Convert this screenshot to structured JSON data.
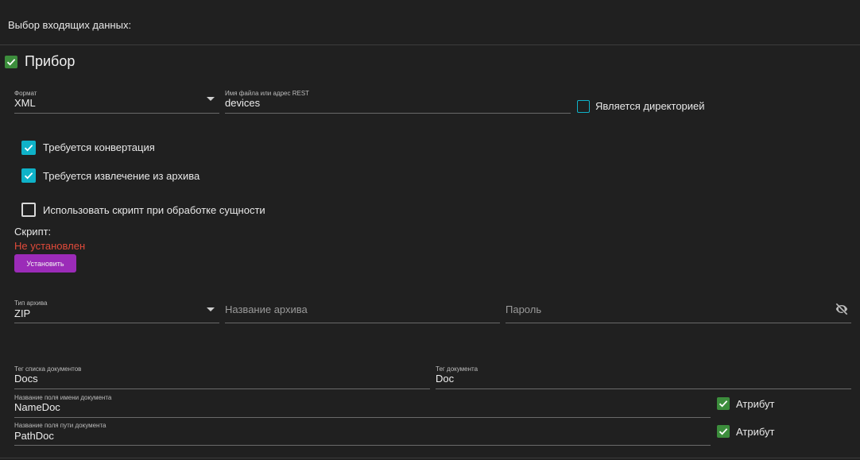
{
  "header": {
    "title": "Выбор входящих данных:"
  },
  "device": {
    "title": "Прибор",
    "enabled": true,
    "format": {
      "label": "Формат",
      "value": "XML"
    },
    "filename": {
      "label": "Имя файла или адрес REST",
      "value": "devices"
    },
    "is_directory": {
      "label": "Является директорией",
      "checked": false
    },
    "needs_conversion": {
      "label": "Требуется конвертация",
      "checked": true
    },
    "needs_extraction": {
      "label": "Требуется извлечение из архива",
      "checked": true
    },
    "use_script": {
      "label": "Использовать скрипт при обработке сущности",
      "checked": false
    },
    "script": {
      "label": "Скрипт:",
      "status": "Не установлен",
      "button_label": "Установить"
    },
    "archive": {
      "type_label": "Тип архива",
      "type_value": "ZIP",
      "name_placeholder": "Название архива",
      "password_placeholder": "Пароль"
    },
    "docs": {
      "list_tag_label": "Тег списка документов",
      "list_tag_value": "Docs",
      "doc_tag_label": "Тег документа",
      "doc_tag_value": "Doc",
      "name_field_label": "Название поля имени документа",
      "name_field_value": "NameDoc",
      "name_attr_label": "Атрибут",
      "path_field_label": "Название поля пути документа",
      "path_field_value": "PathDoc",
      "path_attr_label": "Атрибут"
    }
  },
  "colors": {
    "accent_cyan": "#0fb2c8",
    "accent_green": "#3c8d3c",
    "button_purple": "#9b2bb8",
    "status_red": "#e04a3a"
  }
}
